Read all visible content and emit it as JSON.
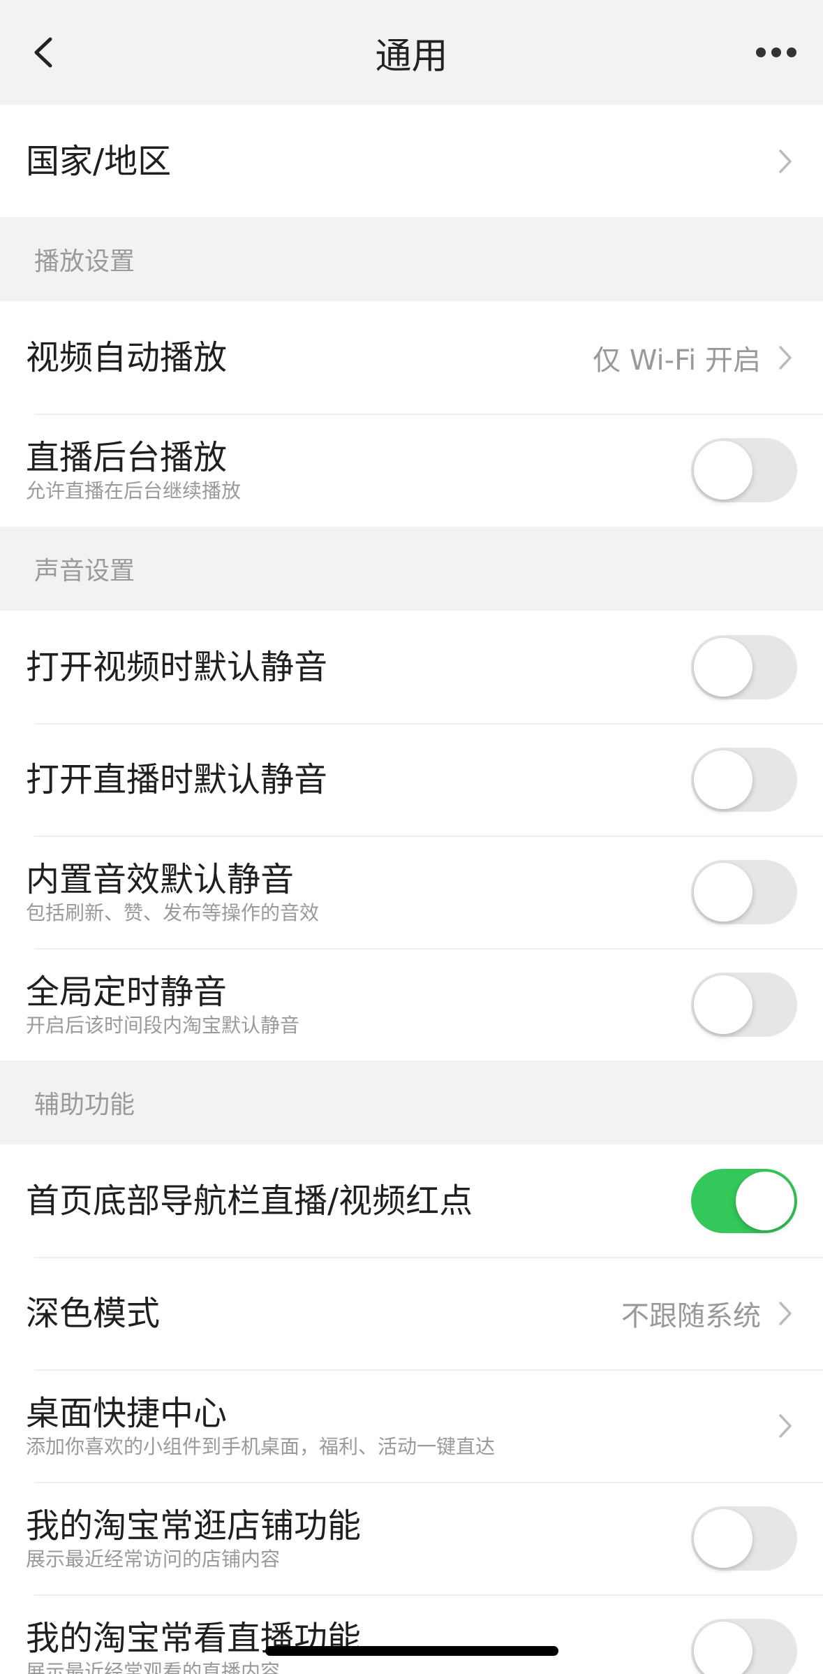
{
  "nav": {
    "title": "通用"
  },
  "country_row": {
    "title": "国家/地区"
  },
  "sections": {
    "playback": "播放设置",
    "sound": "声音设置",
    "accessibility": "辅助功能"
  },
  "playback": {
    "autoplay": {
      "title": "视频自动播放",
      "value": "仅 Wi-Fi 开启"
    },
    "background_live": {
      "title": "直播后台播放",
      "sub": "允许直播在后台继续播放",
      "on": false
    }
  },
  "sound": {
    "video_mute": {
      "title": "打开视频时默认静音",
      "on": false
    },
    "live_mute": {
      "title": "打开直播时默认静音",
      "on": false
    },
    "builtin_mute": {
      "title": "内置音效默认静音",
      "sub": "包括刷新、赞、发布等操作的音效",
      "on": false
    },
    "timed_mute": {
      "title": "全局定时静音",
      "sub": "开启后该时间段内淘宝默认静音",
      "on": false
    }
  },
  "accessibility": {
    "red_dot": {
      "title": "首页底部导航栏直播/视频红点",
      "on": true
    },
    "dark_mode": {
      "title": "深色模式",
      "value": "不跟随系统"
    },
    "desktop_center": {
      "title": "桌面快捷中心",
      "sub": "添加你喜欢的小组件到手机桌面，福利、活动一键直达"
    },
    "frequent_shops": {
      "title": "我的淘宝常逛店铺功能",
      "sub": "展示最近经常访问的店铺内容",
      "on": false
    },
    "frequent_live": {
      "title": "我的淘宝常看直播功能",
      "sub": "展示最近经常观看的直播内容",
      "on": false
    }
  },
  "colors": {
    "toggle_on": "#34c759",
    "toggle_off": "#e6e6e6",
    "background": "#f2f2f2"
  }
}
